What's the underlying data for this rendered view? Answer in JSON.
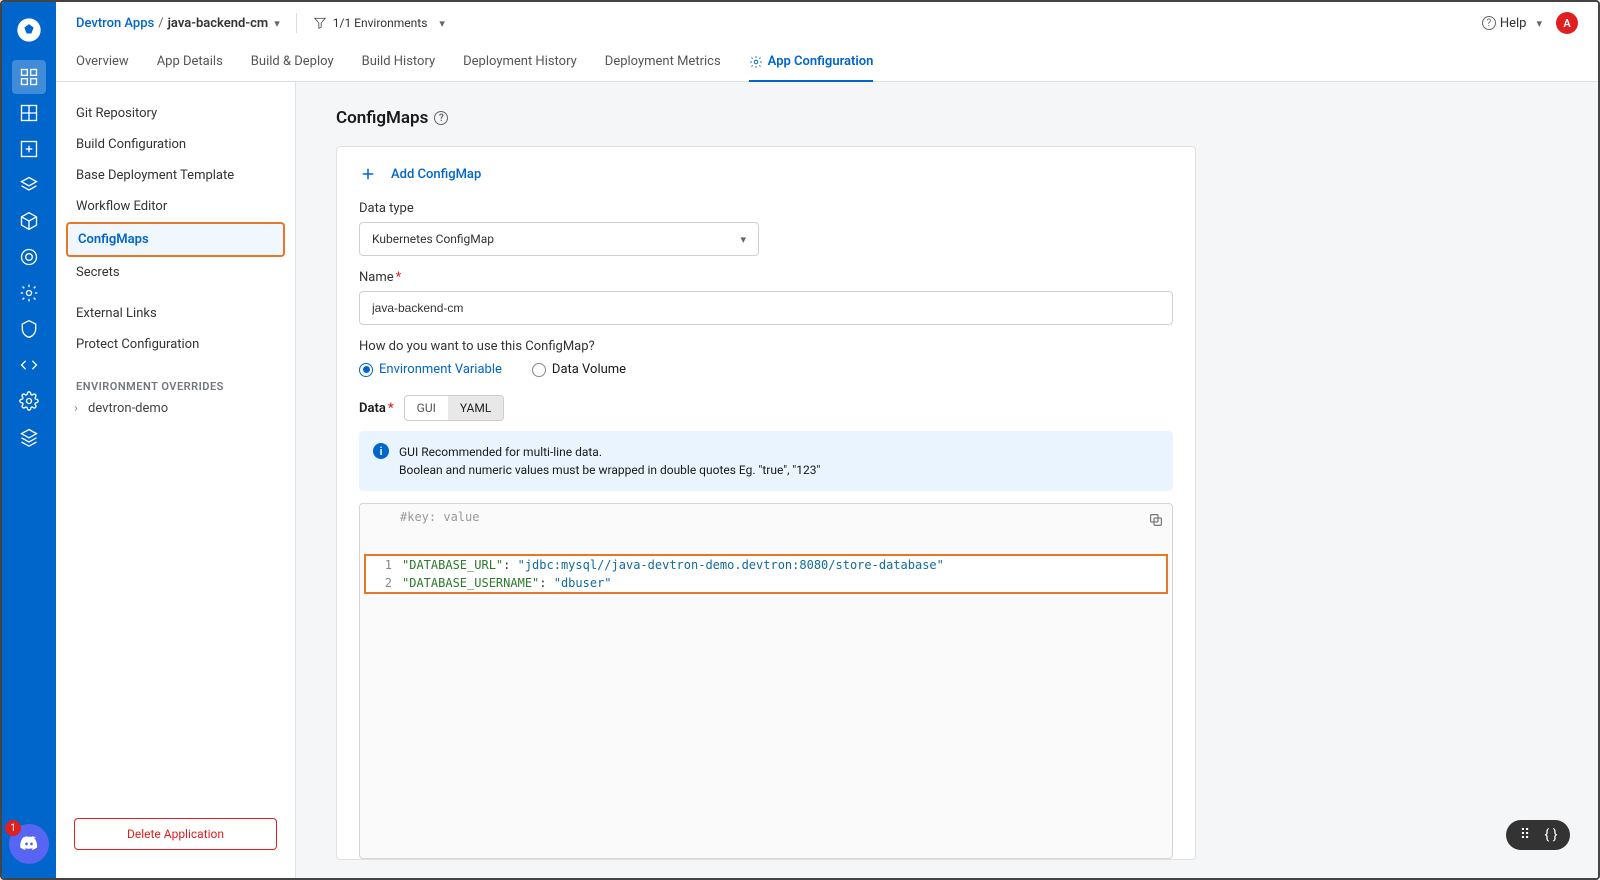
{
  "header": {
    "breadcrumb_root": "Devtron Apps",
    "breadcrumb_app": "java-backend-cm",
    "env_filter": "1/1 Environments",
    "help": "Help",
    "avatar_initial": "A"
  },
  "tabs": [
    {
      "label": "Overview"
    },
    {
      "label": "App Details"
    },
    {
      "label": "Build & Deploy"
    },
    {
      "label": "Build History"
    },
    {
      "label": "Deployment History"
    },
    {
      "label": "Deployment Metrics"
    },
    {
      "label": "App Configuration",
      "active": true
    }
  ],
  "sidebar": {
    "items": [
      {
        "label": "Git Repository"
      },
      {
        "label": "Build Configuration"
      },
      {
        "label": "Base Deployment Template"
      },
      {
        "label": "Workflow Editor"
      },
      {
        "label": "ConfigMaps",
        "active": true
      },
      {
        "label": "Secrets"
      },
      {
        "label": "External Links"
      },
      {
        "label": "Protect Configuration"
      }
    ],
    "overrides_header": "ENVIRONMENT OVERRIDES",
    "overrides": [
      {
        "label": "devtron-demo"
      }
    ],
    "delete_label": "Delete Application"
  },
  "page": {
    "title": "ConfigMaps",
    "add_label": "Add ConfigMap",
    "data_type_label": "Data type",
    "data_type_value": "Kubernetes ConfigMap",
    "name_label": "Name",
    "name_value": "java-backend-cm",
    "usage_label": "How do you want to use this ConfigMap?",
    "radio_env": "Environment Variable",
    "radio_vol": "Data Volume",
    "data_label": "Data",
    "toggle_gui": "GUI",
    "toggle_yaml": "YAML",
    "info_line1": "GUI Recommended for multi-line data.",
    "info_line2": "Boolean and numeric values must be wrapped in double quotes Eg. \"true\", \"123\"",
    "code_hint": "#key: value",
    "code": [
      {
        "n": "1",
        "key": "\"DATABASE_URL\"",
        "val": "\"jdbc:mysql//java-devtron-demo.devtron:8080/store-database\""
      },
      {
        "n": "2",
        "key": "\"DATABASE_USERNAME\"",
        "val": "\"dbuser\""
      }
    ]
  },
  "discord_count": "1"
}
